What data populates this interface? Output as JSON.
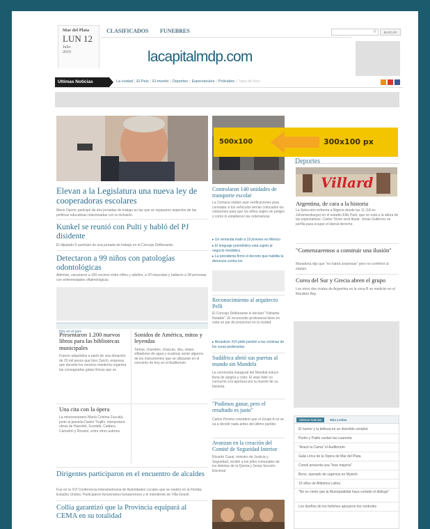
{
  "header": {
    "city": "Mar del Plata",
    "date_day": "LUN 12",
    "date_month": "Julio",
    "date_year": "2010",
    "tabs": [
      "CLASIFICADOS",
      "FUNEBRES"
    ],
    "logo": "lacapitalmdp.com",
    "search_placeholder": "",
    "search_button": "BUSCAR"
  },
  "nav": {
    "title": "Ultimas Noticias",
    "links": [
      "La ciudad",
      "El País",
      "El mundo",
      "Deportes",
      "Espectaculos",
      "Policiales",
      "Tapa de Hoy"
    ]
  },
  "ad_labels": {
    "left": "500x100",
    "right": "300x100 px"
  },
  "colors": {
    "frame": "#1c5a6e",
    "accent": "#2b6f8f",
    "ad_yellow": "#f2c500",
    "arrow": "#f5a623",
    "nav_bar": "#1d1d1d"
  },
  "main": {
    "lead": {
      "title": "Elevan a la Legislatura una nueva ley de cooperadoras escolares",
      "summary": "Mario Oporto participó de dos jornadas de trabajo en las que se repasaron aspectos de las políticas educativas relacionadas con la inclusión."
    },
    "stories": [
      {
        "title": "Kunkel se reunió con Pulti y habló del PJ disidente",
        "summary": "El diputado K participó de una jornada de trabajo en el Concejo Deliberante."
      },
      {
        "title": "Detectaron a 99 niños con patologías odontológicas",
        "summary": "Además, vacunaron a 160 vecinos entre niños y adultos, a 20 mascotas y hallaron a 38 personas con enfermedades oftalmológicas."
      }
    ],
    "section_label": "Hoy en el país",
    "sub1": {
      "title": "Presentaron 1.200 nuevos libros para las bibliotecas municipales",
      "summary": "Fueron adquiridos a partir de una donación de 20 mil pesos que hizo Zurich, empresa que durante los veranos mantenía organiza las consagradas gatas línicas que se"
    },
    "sub2": {
      "title": "Sonidos de América, mitos y leyendas",
      "summary": "Tarkas, charokes, chascas, eku, viejas silbadores de agua y ocarinas serán algunos de los instrumentos que se utilizarán en el concierto de hoy en el Auditorium."
    },
    "sub3": {
      "title": "Una cita con la ópera",
      "summary": "La mezzosoprano María Cristina Zuccalá, junto al pianista Daniel Trujillo, interpretará obras de Haendel, Scarlatti, Caldara, Carissimi y Rossini, entre otros autores."
    },
    "bottom": [
      {
        "title": "Dirigentes participaron en el encuentro de alcaldes",
        "summary": "Fue en la XVI Conferencia Interamericana de Autoridades Locales que se realizó en la Florida, Estados Unidos. Participaron funcionarios bonaerenses y el intendente de Villa Gesell."
      },
      {
        "title": "Collia garantizó que la Provincia equipará al CEMA en su totalidad",
        "summary": ""
      }
    ]
  },
  "middle": {
    "story1": {
      "title": "Controlaron 140 unidades de transporte escolar",
      "summary": "La Comuna realizó ayer verificaciones para constatar si los vehículos tenían colocados los cinturones para que los niños viajen sin peligro y como lo establecen las ordenanzas."
    },
    "links1": [
      "Un remanda mató a 19 jóvenes en México",
      "El lenguaje periodístico está sujeto al negocio mediático",
      "La presidenta firmó el decreto que habilita la denuncia contra los"
    ],
    "story2": {
      "title": "Reconocimiento al arquitecto Pelli",
      "summary": "El Concejo Deliberante lo declaró \"Visitante Notable\". El reconocido profesional tiene en vista un par de proyectos en la ciudad."
    },
    "links2": [
      "Benedicto XVI pidió perdón a las víctimas de los curas pederastas"
    ],
    "story3": {
      "title": "Sudáfrica abrió sus puertas al mundo sin Mandela",
      "summary": "La ceremonia inaugural del Mundial estuvo llena de alegría y color. El viejo líder no concurrió a la apertura por la muerte de su bisnieta."
    },
    "story4": {
      "title": "\"Pudimos ganar, pero el resultado es justo\"",
      "summary": "Carlos Pereira consideró que el Grupo A no se va a decidir nada antes del último partido."
    },
    "story5": {
      "title": "Avanzan en la creación del Comité de Seguridad Interior",
      "summary": "Ricardo Casal, ministro de Justicia y Seguridad, recibió a los jefes comunales de los distritos de la Quinta y Sexta Sección Electoral"
    }
  },
  "right": {
    "section": "Deportes",
    "banner_text": "Villard",
    "story1": {
      "title": "Argentina, de cara a la historia",
      "summary": "La Selección enfrenta a Nigeria desde las 11 (18 en Johannesburgo) en el estadio Ellis Park, que no está a la altura de las expectativas. Carlos Tevez será titular. Jonás Gutiérrez se perfila para ocupar el lateral derecho."
    },
    "story2": {
      "title": "\"Comenzaremos a construir una ilusión\"",
      "summary": "Maradona dijo que \"no habrá sorpresas\" pero no confirmó al equipo."
    },
    "story3": {
      "title": "Corea del Sur y Grecia abren el grupo",
      "summary": "Los otros dos rivales de Argentina en la zona B se medirán en el Mandela Bay."
    },
    "tabs": [
      "Ultimas Noticias",
      "Más Leidas"
    ],
    "list": [
      "El humor y la belleza en un divertido complot",
      "Pedro y Pablo cantan las cuarenta",
      "\"Aracé la Cama\" el Auditorium",
      "Gala Lírica de la Opera de Mar del Plata",
      "Coneli presenta una \"leve mejoría\"",
      "Bono, operado de urgencia en Munich",
      "10 años de Atlántica Latina",
      "\"No es cierto que la Municipalidad haya cortado el diálogo\"",
      "Los dueños de los boliches apoyaron los controles"
    ]
  }
}
